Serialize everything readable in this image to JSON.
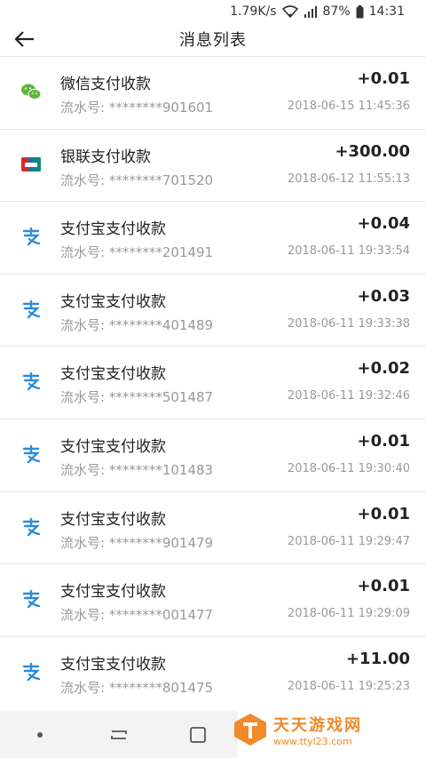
{
  "status_bar": {
    "speed": "1.79K/s",
    "battery": "87%",
    "time": "14:31"
  },
  "header": {
    "title": "消息列表"
  },
  "colors": {
    "wechat": "#5fb73e",
    "alipay": "#2d8cd9",
    "unionpay_red": "#d9272e",
    "watermark": "#f08a2a"
  },
  "items": [
    {
      "icon": "wechat-icon",
      "title": "微信支付收款",
      "serial": "流水号: ********901601",
      "amount": "+0.01",
      "time": "2018-06-15 11:45:36"
    },
    {
      "icon": "unionpay-icon",
      "title": "银联支付收款",
      "serial": "流水号: ********701520",
      "amount": "+300.00",
      "time": "2018-06-12 11:55:13"
    },
    {
      "icon": "alipay-icon",
      "title": "支付宝支付收款",
      "serial": "流水号: ********201491",
      "amount": "+0.04",
      "time": "2018-06-11 19:33:54"
    },
    {
      "icon": "alipay-icon",
      "title": "支付宝支付收款",
      "serial": "流水号: ********401489",
      "amount": "+0.03",
      "time": "2018-06-11 19:33:38"
    },
    {
      "icon": "alipay-icon",
      "title": "支付宝支付收款",
      "serial": "流水号: ********501487",
      "amount": "+0.02",
      "time": "2018-06-11 19:32:46"
    },
    {
      "icon": "alipay-icon",
      "title": "支付宝支付收款",
      "serial": "流水号: ********101483",
      "amount": "+0.01",
      "time": "2018-06-11 19:30:40"
    },
    {
      "icon": "alipay-icon",
      "title": "支付宝支付收款",
      "serial": "流水号: ********901479",
      "amount": "+0.01",
      "time": "2018-06-11 19:29:47"
    },
    {
      "icon": "alipay-icon",
      "title": "支付宝支付收款",
      "serial": "流水号: ********001477",
      "amount": "+0.01",
      "time": "2018-06-11 19:29:09"
    },
    {
      "icon": "alipay-icon",
      "title": "支付宝支付收款",
      "serial": "流水号: ********801475",
      "amount": "+11.00",
      "time": "2018-06-11 19:25:23"
    }
  ],
  "watermark": {
    "title": "天天游戏网",
    "url": "www.ttyl23.com"
  }
}
